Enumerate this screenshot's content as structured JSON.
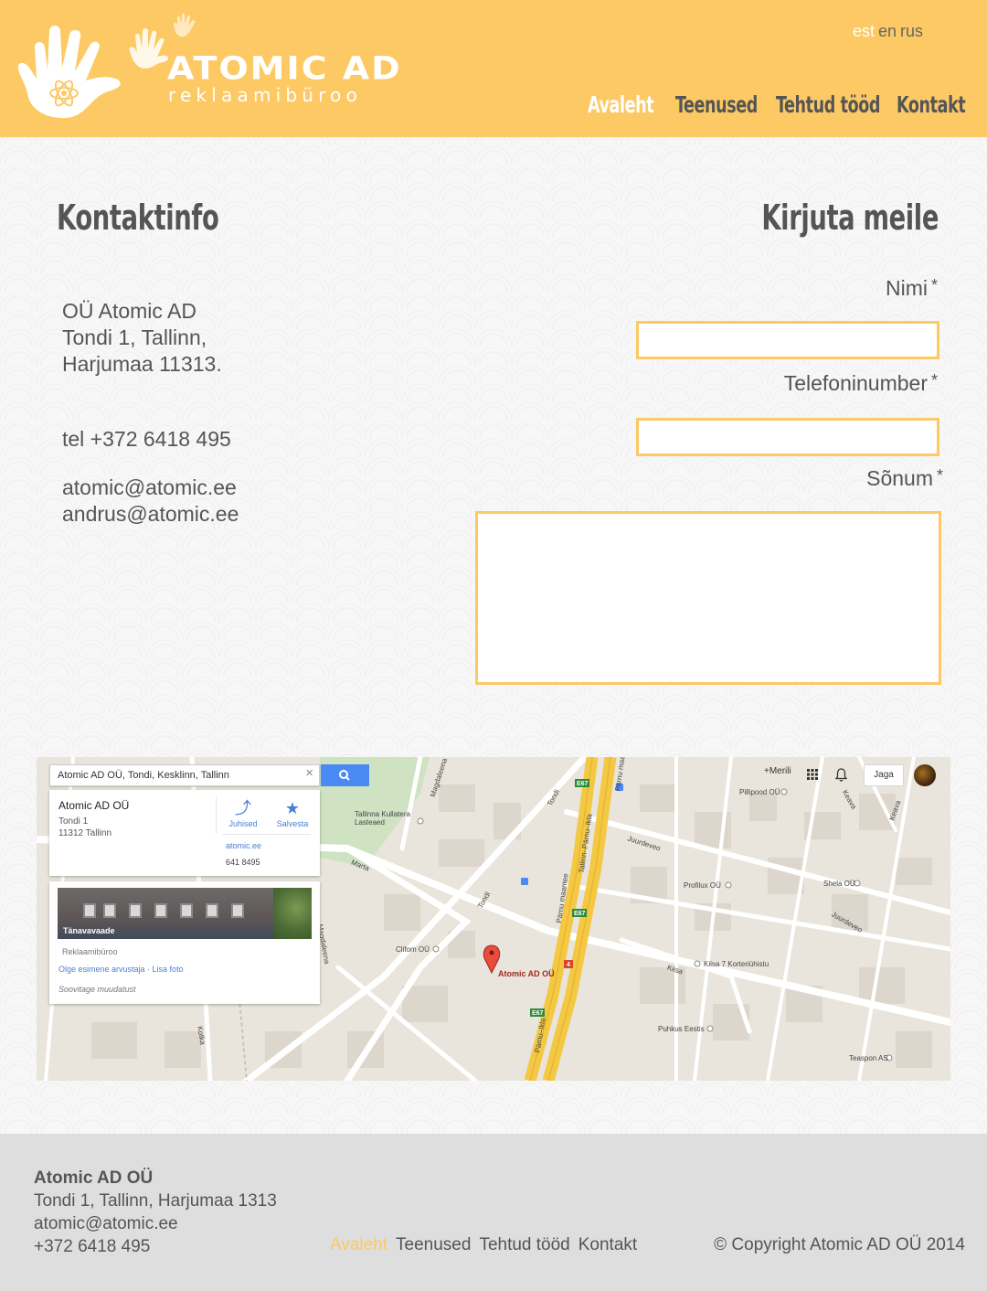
{
  "brand": {
    "title": "ATOMIC AD",
    "subtitle": "reklaamibüroo",
    "colors": {
      "accent": "#fdc964",
      "text": "#555555",
      "footer_bg": "#dedede"
    }
  },
  "languages": [
    {
      "label": "est",
      "active": true
    },
    {
      "label": "en",
      "active": false
    },
    {
      "label": "rus",
      "active": false
    }
  ],
  "nav": [
    {
      "label": "Avaleht",
      "active": true
    },
    {
      "label": "Teenused",
      "active": false
    },
    {
      "label": "Tehtud tööd",
      "active": false
    },
    {
      "label": "Kontakt",
      "active": false
    }
  ],
  "contact": {
    "heading": "Kontaktinfo",
    "address_lines": [
      "OÜ Atomic AD",
      "Tondi 1, Tallinn,",
      "Harjumaa 11313."
    ],
    "tel": "tel +372 6418 495",
    "emails": [
      "atomic@atomic.ee",
      "andrus@atomic.ee"
    ]
  },
  "form": {
    "heading": "Kirjuta meile",
    "name_label": "Nimi",
    "phone_label": "Telefoninumber",
    "message_label": "Sõnum",
    "required_mark": "*",
    "name_value": "",
    "phone_value": "",
    "message_value": ""
  },
  "map": {
    "search_value": "Atomic AD OÜ, Tondi, Kesklinn, Tallinn",
    "place_name": "Atomic AD OÜ",
    "place_address_lines": [
      "Tondi 1",
      "11312 Tallinn"
    ],
    "directions_label": "Juhised",
    "save_label": "Salvesta",
    "website": "atomic.ee",
    "phone": "641 8495",
    "streetview_label": "Tänavavaade",
    "category": "Reklaamibüroo",
    "review_link": "Olge esimene arvustaja · Lisa foto",
    "suggest_edit": "Soovitage muudatust",
    "top_user": "+Merili",
    "share_label": "Jaga",
    "pin_label": "Atomic AD OÜ",
    "places": [
      "Pillipood OÜ",
      "Tallinna Kullatera Lasteaed",
      "Profilux OÜ",
      "Shela OÜ",
      "Clifom OÜ",
      "Kiisa 7 Korteriühistu",
      "Puhkus Eestis",
      "Teaspon AS"
    ],
    "streets": [
      "Magdaleena",
      "Tondi",
      "Pärnu maantee",
      "Tallinn–Pärnu–Ikla",
      "Pärnu maant",
      "Marta",
      "Juurdeveo",
      "Kiisa",
      "Keava",
      "Kotka",
      "Pärnu–Ikla",
      "Kolde",
      "Raba"
    ],
    "road_badges": [
      "E67",
      "E67",
      "E67",
      "4"
    ]
  },
  "footer": {
    "company": "Atomic AD OÜ",
    "address": "Tondi 1, Tallinn, Harjumaa 1313",
    "email": "atomic@atomic.ee",
    "phone": "+372 6418 495",
    "nav": [
      {
        "label": "Avaleht",
        "active": true
      },
      {
        "label": "Teenused",
        "active": false
      },
      {
        "label": "Tehtud tööd",
        "active": false
      },
      {
        "label": "Kontakt",
        "active": false
      }
    ],
    "copyright": "© Copyright Atomic AD OÜ 2014"
  }
}
